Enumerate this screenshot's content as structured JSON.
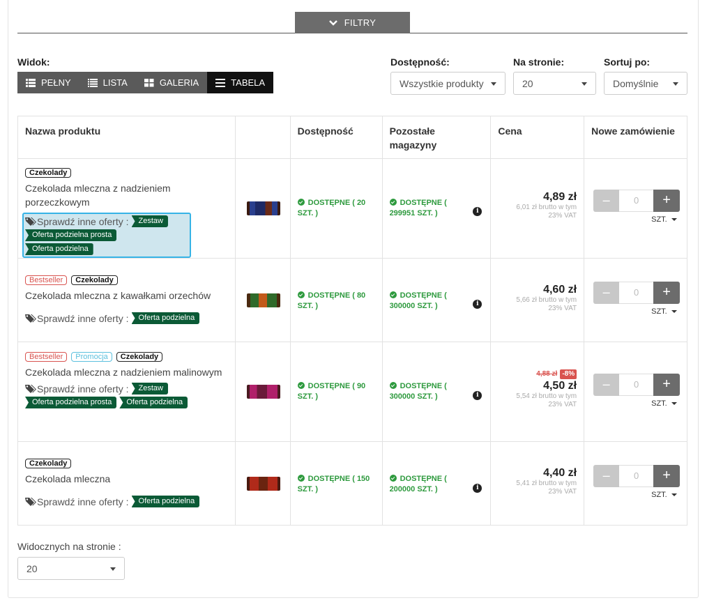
{
  "filters": {
    "label": "FILTRY"
  },
  "view": {
    "label": "Widok:",
    "buttons": [
      {
        "label": "PEŁNY",
        "icon": "list-full-icon",
        "active": false
      },
      {
        "label": "LISTA",
        "icon": "list-icon",
        "active": false
      },
      {
        "label": "GALERIA",
        "icon": "grid-icon",
        "active": false
      },
      {
        "label": "TABELA",
        "icon": "table-icon",
        "active": true
      }
    ]
  },
  "availability_filter": {
    "label": "Dostępność:",
    "value": "Wszystkie produkty"
  },
  "per_page": {
    "label": "Na stronie:",
    "value": "20"
  },
  "sort": {
    "label": "Sortuj po:",
    "value": "Domyślnie"
  },
  "table": {
    "headers": {
      "name": "Nazwa produktu",
      "image": "",
      "availability": "Dostępność",
      "stock": "Pozostałe magazyny",
      "price": "Cena",
      "order": "Nowe zamówienie"
    },
    "offers_label": "Sprawdź inne oferty :",
    "rows": [
      {
        "badges": [
          "Czekolady"
        ],
        "name": "Czekolada mleczna z nadzieniem porzeczkowym",
        "offers": [
          "Zestaw",
          "Oferta podzielna prosta",
          "Oferta podzielna"
        ],
        "availability": "DOSTĘPNE ( 20 SZT. )",
        "stock": "DOSTĘPNE ( 299951 SZT. )",
        "old_price": "",
        "discount": "",
        "price": "4,89 zł",
        "gross": "6,01 zł brutto w tym",
        "vat": "23% VAT",
        "qty": "0",
        "unit": "SZT."
      },
      {
        "badges": [
          "Bestseller",
          "Czekolady"
        ],
        "name": "Czekolada mleczna z kawałkami orzechów",
        "offers": [
          "Oferta podzielna"
        ],
        "availability": "DOSTĘPNE ( 80 SZT. )",
        "stock": "DOSTĘPNE ( 300000 SZT. )",
        "old_price": "",
        "discount": "",
        "price": "4,60 zł",
        "gross": "5,66 zł brutto w tym",
        "vat": "23% VAT",
        "qty": "0",
        "unit": "SZT."
      },
      {
        "badges": [
          "Bestseller",
          "Promocja",
          "Czekolady"
        ],
        "name": "Czekolada mleczna z nadzieniem malinowym",
        "offers": [
          "Zestaw",
          "Oferta podzielna prosta",
          "Oferta podzielna"
        ],
        "availability": "DOSTĘPNE ( 90 SZT. )",
        "stock": "DOSTĘPNE ( 300000 SZT. )",
        "old_price": "4,88 zł",
        "discount": "-8%",
        "price": "4,50 zł",
        "gross": "5,54 zł brutto w tym",
        "vat": "23% VAT",
        "qty": "0",
        "unit": "SZT."
      },
      {
        "badges": [
          "Czekolady"
        ],
        "name": "Czekolada mleczna",
        "offers": [
          "Oferta podzielna"
        ],
        "availability": "DOSTĘPNE ( 150 SZT. )",
        "stock": "DOSTĘPNE ( 200000 SZT. )",
        "old_price": "",
        "discount": "",
        "price": "4,40 zł",
        "gross": "5,41 zł brutto w tym",
        "vat": "23% VAT",
        "qty": "0",
        "unit": "SZT."
      }
    ]
  },
  "bottom": {
    "label": "Widocznych na stronie :",
    "value": "20"
  },
  "colors": {
    "available_green": "#2e9a3e",
    "offer_tag_green": "#0b5a36",
    "discount_red": "#d9534f",
    "highlight_blue": "#36b3e6"
  }
}
